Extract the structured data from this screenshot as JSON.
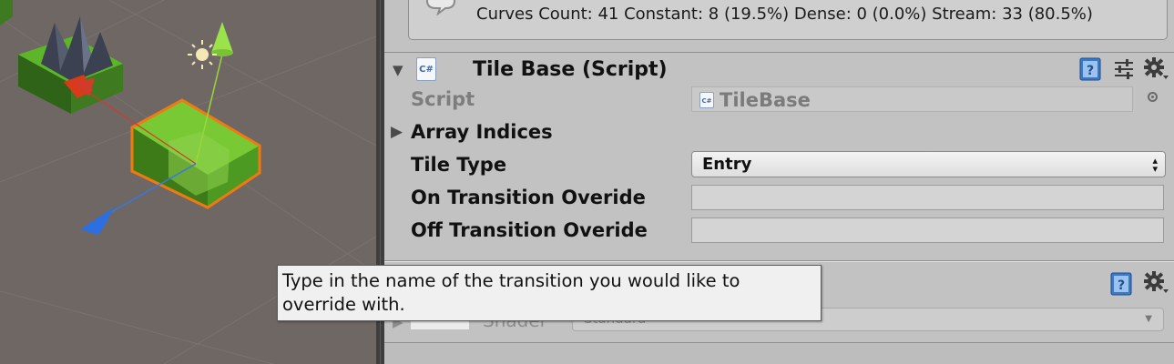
{
  "inspector": {
    "animation_info": "Curves Count: 41 Constant: 8 (19.5%) Dense: 0 (0.0%) Stream: 33 (80.5%)",
    "component": {
      "title": "Tile Base (Script)",
      "script_icon_text": "C#",
      "fields": {
        "script_label": "Script",
        "script_value": "TileBase",
        "array_indices_label": "Array Indices",
        "tile_type_label": "Tile Type",
        "tile_type_value": "Entry",
        "on_transition_label": "On Transition Overide",
        "on_transition_value": "",
        "off_transition_label": "Off Transition Overide",
        "off_transition_value": ""
      }
    },
    "material": {
      "shader_label": "Shader",
      "shader_value": "Standard"
    },
    "icons": {
      "help": "help-book-icon",
      "presets": "preset-sliders-icon",
      "settings": "gear-icon"
    }
  },
  "tooltip": {
    "text": "Type in the name of the transition you would like to override with."
  },
  "colors": {
    "inspector_bg": "#c2c2c2",
    "scene_bg": "#6f6764",
    "selection_outline": "#f07a10",
    "tile_green": "#6fbf2e"
  }
}
